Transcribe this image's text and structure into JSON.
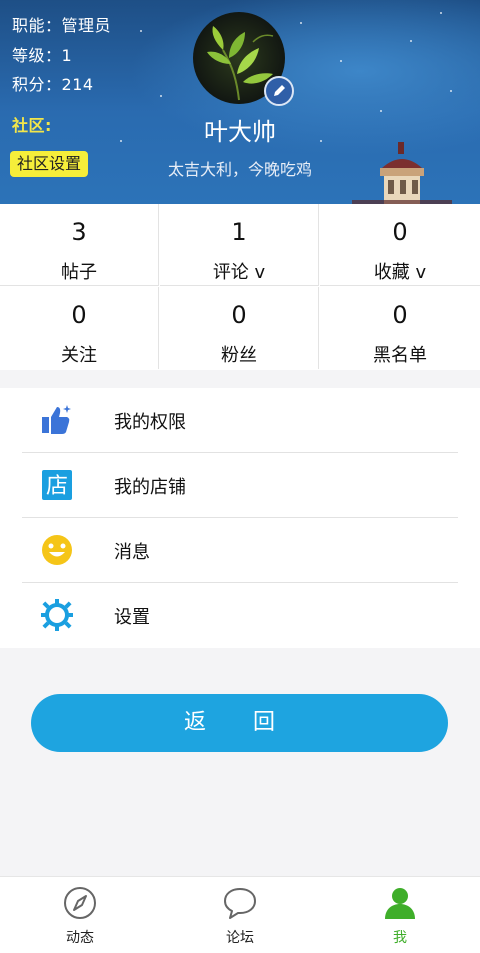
{
  "profile": {
    "role_label": "职能：",
    "role_value": "管理员",
    "level_label": "等级：",
    "level_value": "1",
    "points_label": "积分：",
    "points_value": "214",
    "community_label": "社区:",
    "community_settings": "社区设置",
    "name": "叶大帅",
    "signature": "太吉大利，今晚吃鸡"
  },
  "stats": [
    {
      "value": "3",
      "label": "帖子"
    },
    {
      "value": "1",
      "label": "评论 v"
    },
    {
      "value": "0",
      "label": "收藏 v"
    },
    {
      "value": "0",
      "label": "关注"
    },
    {
      "value": "0",
      "label": "粉丝"
    },
    {
      "value": "0",
      "label": "黑名单"
    }
  ],
  "menu": [
    {
      "label": "我的权限",
      "icon": "thumbs-up-icon"
    },
    {
      "label": "我的店铺",
      "icon": "store-icon",
      "icon_text": "店"
    },
    {
      "label": "消息",
      "icon": "smiley-icon"
    },
    {
      "label": "设置",
      "icon": "gear-icon"
    }
  ],
  "back_button": "返 回",
  "tabs": [
    {
      "label": "动态",
      "icon": "compass-icon"
    },
    {
      "label": "论坛",
      "icon": "chat-bubble-icon"
    },
    {
      "label": "我",
      "icon": "person-icon",
      "active": true
    }
  ],
  "colors": {
    "accent": "#1ea4e0",
    "active_tab": "#3fae2a",
    "badge": "#f6ee3a"
  }
}
